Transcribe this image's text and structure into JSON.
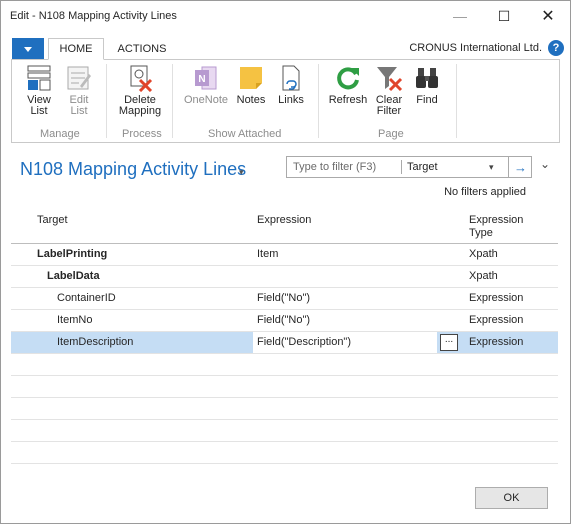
{
  "window": {
    "title": "Edit - N108 Mapping Activity Lines",
    "minimize": "—",
    "maximize": "☐",
    "close": "✕"
  },
  "ribbon": {
    "tabs": [
      {
        "label": "HOME"
      },
      {
        "label": "ACTIONS"
      }
    ],
    "company": "CRONUS International Ltd.",
    "help": "?",
    "buttons": {
      "view_list": "View List",
      "edit_list": "Edit List",
      "delete_mapping": "Delete Mapping",
      "onenote": "OneNote",
      "notes": "Notes",
      "links": "Links",
      "refresh": "Refresh",
      "clear_filter": "Clear Filter",
      "find": "Find"
    },
    "groups": {
      "manage": "Manage",
      "process": "Process",
      "show_attached": "Show Attached",
      "page": "Page"
    },
    "colors": {
      "accent": "#1f6fbf",
      "delete": "#e0452b",
      "notes": "#f5c242",
      "refresh": "#2f9e44",
      "onenote": "#7b3fa6"
    }
  },
  "page": {
    "title": "N108 Mapping Activity Lines",
    "filter_placeholder": "Type to filter (F3)",
    "filter_field": "Target",
    "no_filters": "No filters applied"
  },
  "grid": {
    "headers": {
      "target": "Target",
      "expression": "Expression",
      "expression_type": "Expression Type"
    },
    "rows": [
      {
        "target": "LabelPrinting",
        "expression": "Item",
        "type": "Xpath",
        "bold": true,
        "indent": 0
      },
      {
        "target": "LabelData",
        "expression": "",
        "type": "Xpath",
        "bold": true,
        "indent": 1
      },
      {
        "target": "ContainerID",
        "expression": "Field(\"No\")",
        "type": "Expression",
        "bold": false,
        "indent": 2
      },
      {
        "target": "ItemNo",
        "expression": "Field(\"No\")",
        "type": "Expression",
        "bold": false,
        "indent": 2
      },
      {
        "target": "ItemDescription",
        "expression": "Field(\"Description\")",
        "type": "Expression",
        "bold": false,
        "indent": 2,
        "selected": true
      }
    ],
    "assist_edit": "..."
  },
  "footer": {
    "ok": "OK"
  }
}
